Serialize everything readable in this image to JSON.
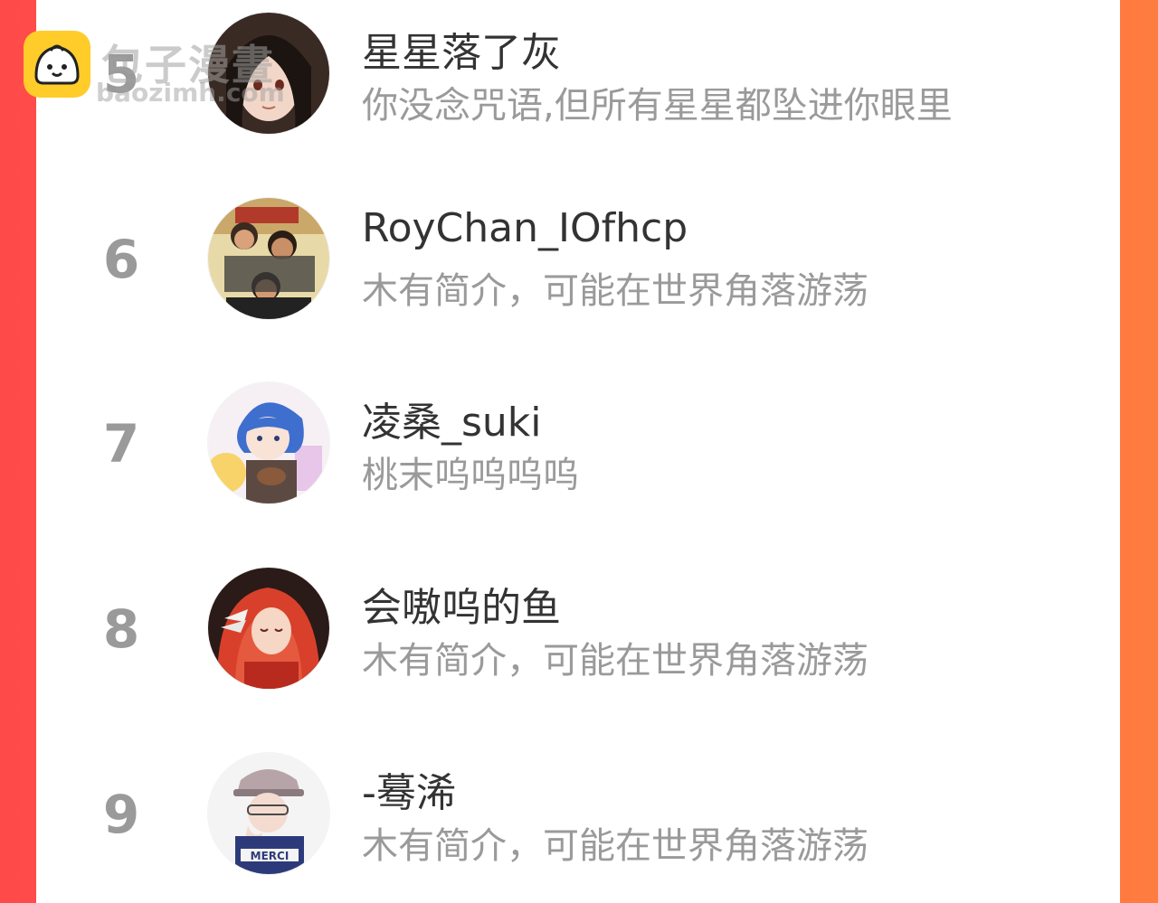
{
  "watermark": {
    "name": "包子漫畫",
    "url": "baozimh.com",
    "icon": "bun-logo-icon"
  },
  "colors": {
    "frame_left": "#ff4a4a",
    "frame_right": "#ff7c40",
    "panel": "#ffffff",
    "rank_text": "#9a9a9a",
    "name_text": "#333333",
    "bio_text": "#9a9a9a"
  },
  "ranking": {
    "entries": [
      {
        "rank": "5",
        "name": "星星落了灰",
        "bio": "你没念咒语,但所有星星都坠进你眼里",
        "avatar": "avatar-dark-hair-girl-icon"
      },
      {
        "rank": "6",
        "name": "RoyChan_IOfhcp",
        "bio": "木有简介，可能在世界角落游荡",
        "avatar": "avatar-group-photo-icon"
      },
      {
        "rank": "7",
        "name": "凌桑_suki",
        "bio": "桃末呜呜呜呜",
        "avatar": "avatar-blue-hair-boy-icon"
      },
      {
        "rank": "8",
        "name": "会嗷呜的鱼",
        "bio": "木有简介，可能在世界角落游荡",
        "avatar": "avatar-red-hair-girl-icon"
      },
      {
        "rank": "9",
        "name": "-蓦浠",
        "bio": "木有简介，可能在世界角落游荡",
        "avatar": "avatar-cap-boy-icon"
      }
    ]
  }
}
